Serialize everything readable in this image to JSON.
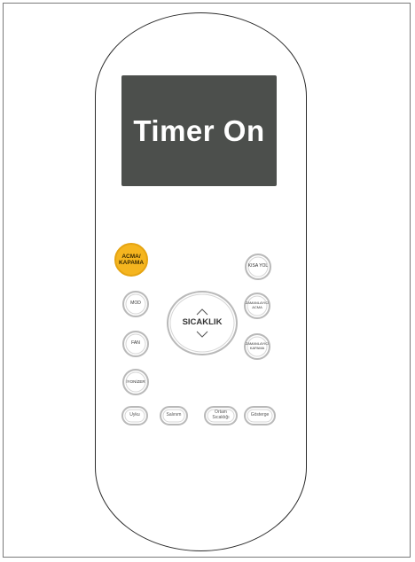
{
  "display": {
    "text": "Timer On"
  },
  "buttons": {
    "power": "ACMA/\nKAPAMA",
    "shortcut": "KISA YOL",
    "mode": "MOD",
    "temperature": "SICAKLIK",
    "timer_on": "ZAMANLAYICI\nACMA",
    "fan": "FAN",
    "timer_off": "ZAMANLAYICI\nKAPAMA",
    "ionizer": "İYONİZER",
    "sleep": "Uyku",
    "swing": "Salınım",
    "room_temp": "Ortam\nSıcaklığı",
    "display": "Gösterge"
  },
  "colors": {
    "power_button": "#f5b51f",
    "display_bg": "#4c4f4c"
  }
}
